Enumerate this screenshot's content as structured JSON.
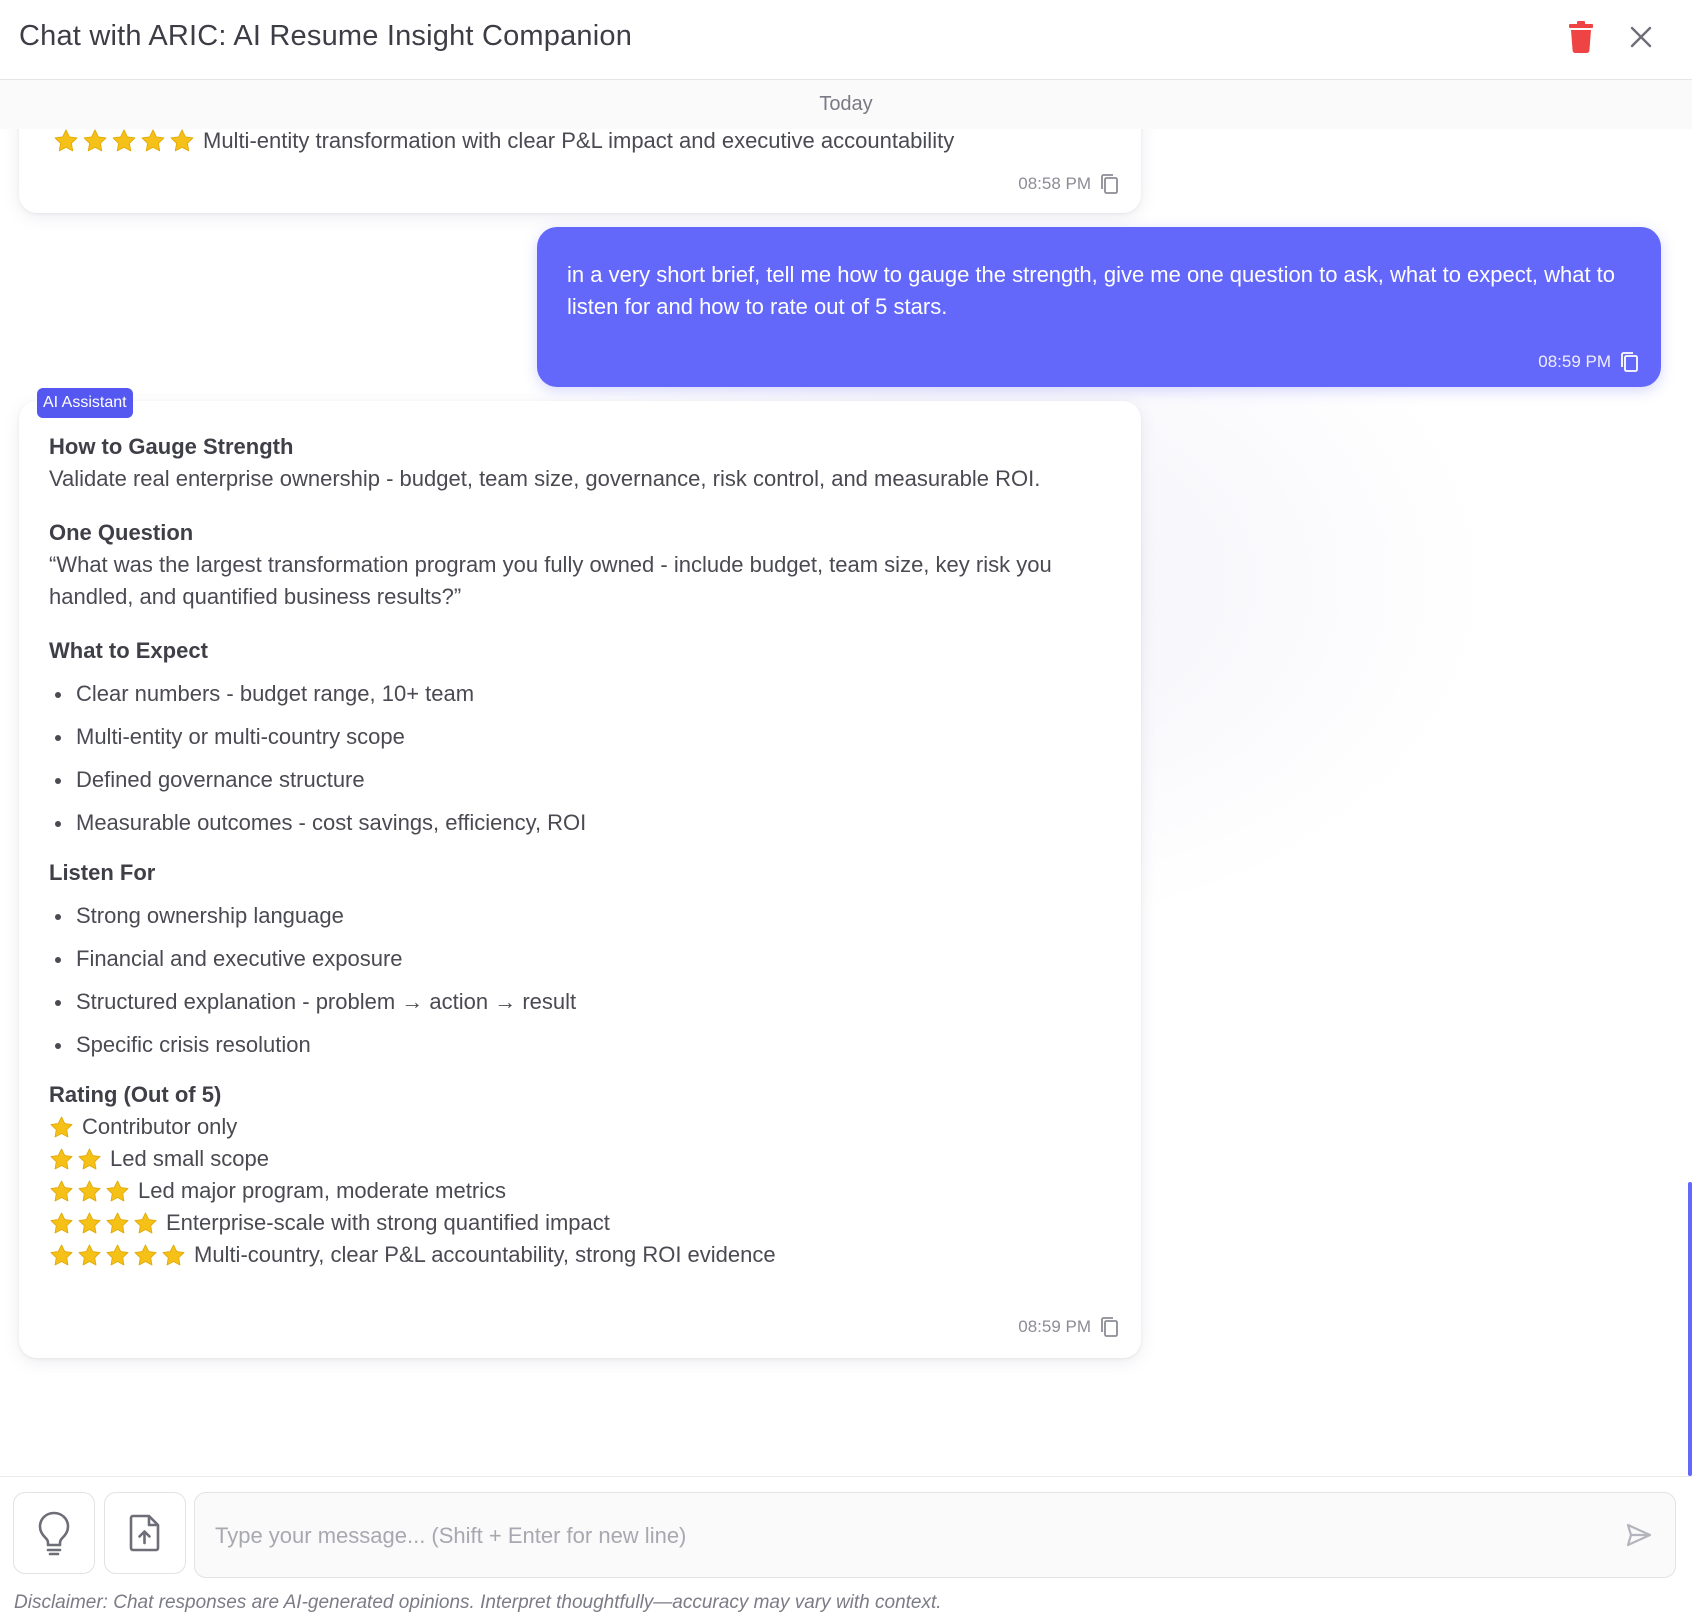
{
  "header": {
    "title": "Chat with ARIC: AI Resume Insight Companion",
    "trash_icon": "trash-icon",
    "close_icon": "close-icon"
  },
  "chat": {
    "date_label": "Today",
    "previous_message": {
      "stars": 5,
      "text": "Multi-entity transformation with clear P&L impact and executive accountability",
      "time": "08:58 PM"
    },
    "user_message": {
      "text": "in a very short brief, tell me how to gauge the strength, give me one question to ask, what to expect, what to listen for and how to rate out of 5 stars.",
      "time": "08:59 PM"
    },
    "assistant_badge": "AI Assistant",
    "assistant_message": {
      "gauge_heading": "How to Gauge Strength",
      "gauge_text": "Validate real enterprise ownership - budget, team size, governance, risk control, and measurable ROI.",
      "question_heading": "One Question",
      "question_text": "“What was the largest transformation program you fully owned - include budget, team size, key risk you handled, and quantified business results?”",
      "expect_heading": "What to Expect",
      "expect_items": [
        "Clear numbers - budget range, 10+ team",
        "Multi-entity or multi-country scope",
        "Defined governance structure",
        "Measurable outcomes - cost savings, efficiency, ROI"
      ],
      "listen_heading": "Listen For",
      "listen_items": [
        "Strong ownership language",
        "Financial and executive exposure",
        "Structured explanation - problem → action → result",
        "Specific crisis resolution"
      ],
      "rating_heading": "Rating (Out of 5)",
      "ratings": [
        {
          "stars": 1,
          "text": "Contributor only"
        },
        {
          "stars": 2,
          "text": "Led small scope"
        },
        {
          "stars": 3,
          "text": "Led major program, moderate metrics"
        },
        {
          "stars": 4,
          "text": "Enterprise-scale with strong quantified impact"
        },
        {
          "stars": 5,
          "text": "Multi-country, clear P&L accountability, strong ROI evidence"
        }
      ],
      "time": "08:59 PM"
    }
  },
  "input": {
    "placeholder": "Type your message... (Shift + Enter for new line)",
    "value": "",
    "lightbulb_icon": "lightbulb-icon",
    "upload_icon": "file-upload-icon",
    "send_icon": "send-icon"
  },
  "disclaimer": "Disclaimer: Chat responses are AI-generated opinions. Interpret thoughtfully—accuracy may vary with context.",
  "colors": {
    "accent": "#6368fb",
    "badge": "#5458f0",
    "trash": "#ef4444",
    "star": "#f5c118"
  }
}
